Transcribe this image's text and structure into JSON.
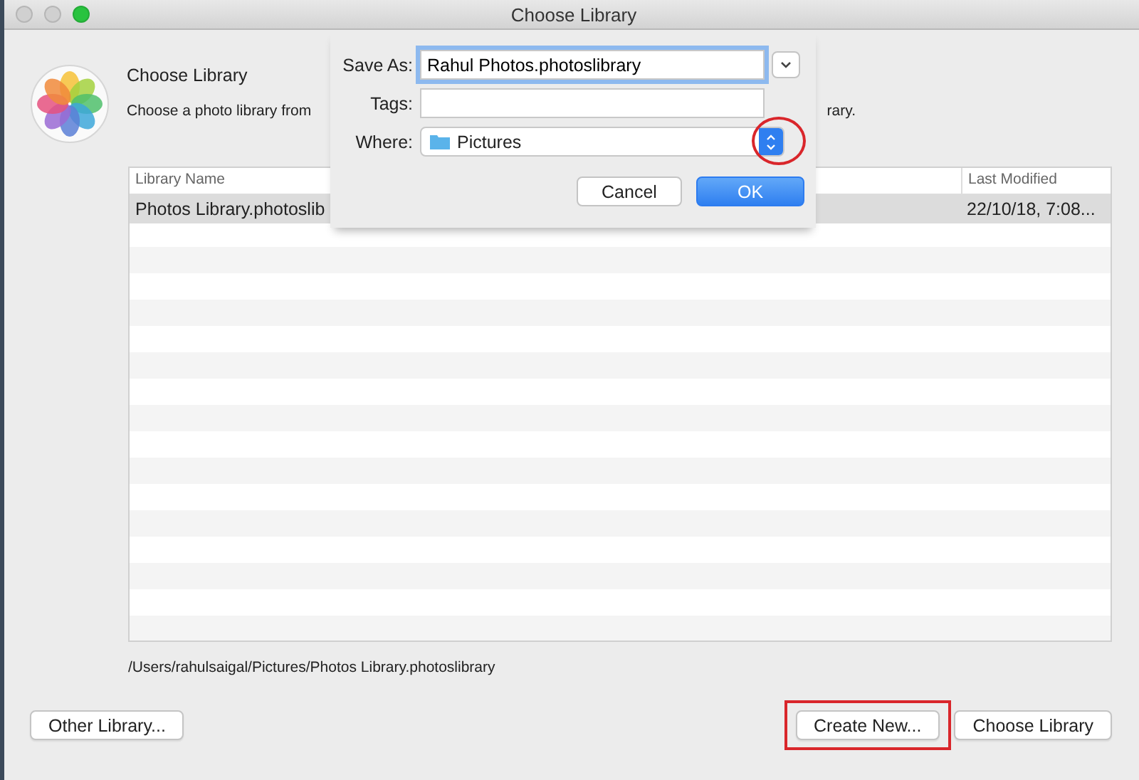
{
  "window": {
    "title": "Choose Library"
  },
  "header": {
    "title": "Choose Library",
    "description_start": "Choose a photo library from",
    "description_end": "rary."
  },
  "table": {
    "columns": [
      "Library Name",
      "Last Modified"
    ],
    "rows": [
      {
        "cells": [
          "Photos Library.photoslib",
          "22/10/18, 7:08..."
        ],
        "selected": true
      }
    ]
  },
  "path": "/Users/rahulsaigal/Pictures/Photos Library.photoslibrary",
  "buttons": [
    {
      "label": "Other Library...",
      "highlighted": false
    },
    {
      "label": "Create New...",
      "highlighted": true
    },
    {
      "label": "Choose Library",
      "highlighted": false
    }
  ],
  "sheet": {
    "save_as": {
      "label": "Save As:",
      "value": "Rahul Photos.photoslibrary"
    },
    "tags": {
      "label": "Tags:"
    },
    "where": {
      "label": "Where:",
      "value": "Pictures",
      "highlighted": true
    },
    "buttons": [
      {
        "label": "Cancel",
        "default": false
      },
      {
        "label": "OK",
        "default": true
      }
    ]
  }
}
